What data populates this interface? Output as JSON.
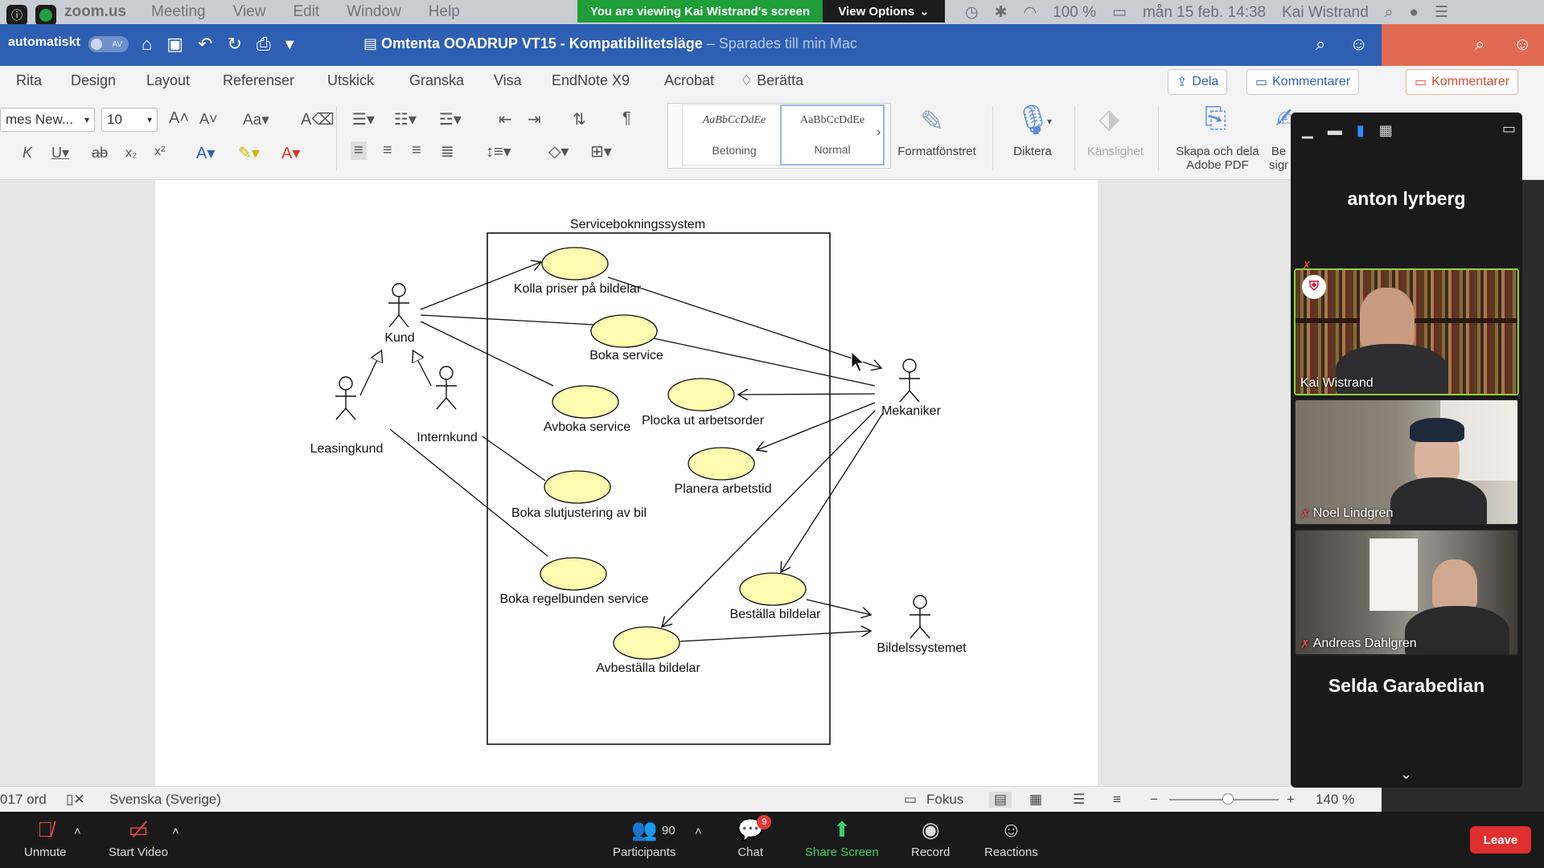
{
  "mac_menubar": {
    "app": "zoom.us",
    "menus": [
      "Meeting",
      "View",
      "Edit",
      "Window",
      "Help"
    ],
    "viewing_banner": "You are viewing Kai Wistrand's screen",
    "view_options": "View Options",
    "battery": "100 %",
    "datetime": "mån 15 feb. 14:38",
    "user": "Kai Wistrand"
  },
  "word_titlebar": {
    "autosave_label": "automatiskt",
    "autosave_toggle": "AV",
    "doc_title": "Omtenta OOADRUP VT15  -  Kompatibilitetsläge",
    "saved_status": "– Sparades till min Mac"
  },
  "ribbon_tabs": [
    "Rita",
    "Design",
    "Layout",
    "Referenser",
    "Utskick",
    "Granska",
    "Visa",
    "EndNote X9",
    "Acrobat",
    "Berätta"
  ],
  "share_label": "Dela",
  "comments_label": "Kommentarer",
  "ribbon": {
    "font_name": "mes New...",
    "font_size": "10",
    "style_sample": "AaBbCcDdEe",
    "styles": [
      "Betoning",
      "Normal"
    ],
    "format_pane": "Formatfönstret",
    "dictate": "Diktera",
    "sensitivity": "Känslighet",
    "adobe_pdf": "Skapa och dela\nAdobe PDF",
    "adobe_sign": "Be\nsign"
  },
  "diagram": {
    "system_title": "Servicebokningssystem",
    "actors": [
      "Kund",
      "Leasingkund",
      "Internkund",
      "Mekaniker",
      "Bildelssystemet"
    ],
    "use_cases": [
      "Kolla priser på bildelar",
      "Boka service",
      "Avboka service",
      "Plocka ut arbetsorder",
      "Planera arbetstid",
      "Boka slutjustering av bil",
      "Boka regelbunden service",
      "Beställa bildelar",
      "Avbeställa bildelar"
    ]
  },
  "statusbar": {
    "words": "017 ord",
    "language": "Svenska (Sverige)",
    "focus": "Fokus",
    "zoom": "140 %"
  },
  "gallery": {
    "participants": [
      {
        "name": "anton lyrberg",
        "video": false,
        "muted": true
      },
      {
        "name": "Kai Wistrand",
        "video": true,
        "muted": false
      },
      {
        "name": "Noel Lindgren",
        "video": true,
        "muted": true
      },
      {
        "name": "Andreas Dahlgren",
        "video": true,
        "muted": true
      },
      {
        "name": "Selda Garabedian",
        "video": false,
        "muted": true
      }
    ]
  },
  "zoom_toolbar": {
    "unmute": "Unmute",
    "start_video": "Start Video",
    "participants": "Participants",
    "participants_count": "90",
    "chat": "Chat",
    "chat_badge": "9",
    "share_screen": "Share Screen",
    "record": "Record",
    "reactions": "Reactions",
    "leave": "Leave"
  },
  "colors": {
    "word_blue": "#2e5fb2",
    "zoom_green": "#1f9e3a",
    "usecase_fill": "#fdfbb0",
    "leave_red": "#e02f2f"
  }
}
